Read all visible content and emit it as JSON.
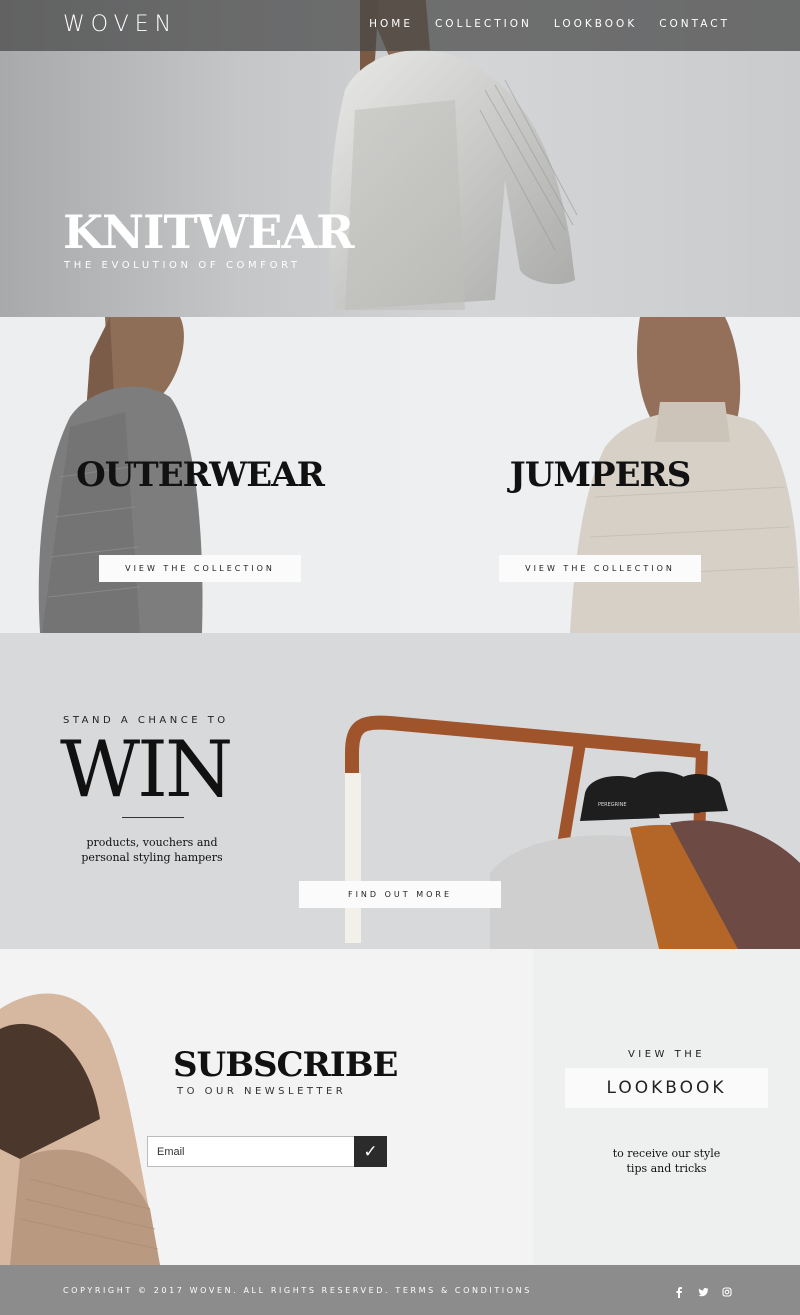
{
  "brand": {
    "logo": "WOVEN"
  },
  "nav": {
    "items": [
      {
        "label": "HOME"
      },
      {
        "label": "COLLECTION"
      },
      {
        "label": "LOOKBOOK"
      },
      {
        "label": "CONTACT"
      }
    ]
  },
  "hero": {
    "title": "KNITWEAR",
    "subtitle": "THE EVOLUTION OF COMFORT"
  },
  "categories": [
    {
      "title": "OUTERWEAR",
      "button": "VIEW THE COLLECTION"
    },
    {
      "title": "JUMPERS",
      "button": "VIEW THE COLLECTION"
    }
  ],
  "promo": {
    "kicker": "STAND A CHANCE TO",
    "title": "WIN",
    "description_line1": "products, vouchers and",
    "description_line2": "personal styling hampers",
    "button": "FIND OUT MORE",
    "hanger_label": "PEREGRINE"
  },
  "subscribe": {
    "title": "SUBSCRIBE",
    "subtitle": "TO OUR NEWSLETTER",
    "email_placeholder": "Email",
    "submit_glyph": "✓"
  },
  "lookbook": {
    "kicker": "VIEW THE",
    "button": "LOOKBOOK",
    "description_line1": "to receive our style",
    "description_line2": "tips and tricks"
  },
  "footer": {
    "copyright": "COPYRIGHT © 2017 WOVEN. ALL RIGHTS RESERVED.",
    "terms": "TERMS & CONDITIONS",
    "social": [
      "facebook-icon",
      "twitter-icon",
      "instagram-icon"
    ]
  },
  "colors": {
    "header_overlay": "#464646",
    "footer_bg": "#8c8c8c",
    "promo_bg": "#d8d9db",
    "submit_bg": "#2b2b2b"
  }
}
